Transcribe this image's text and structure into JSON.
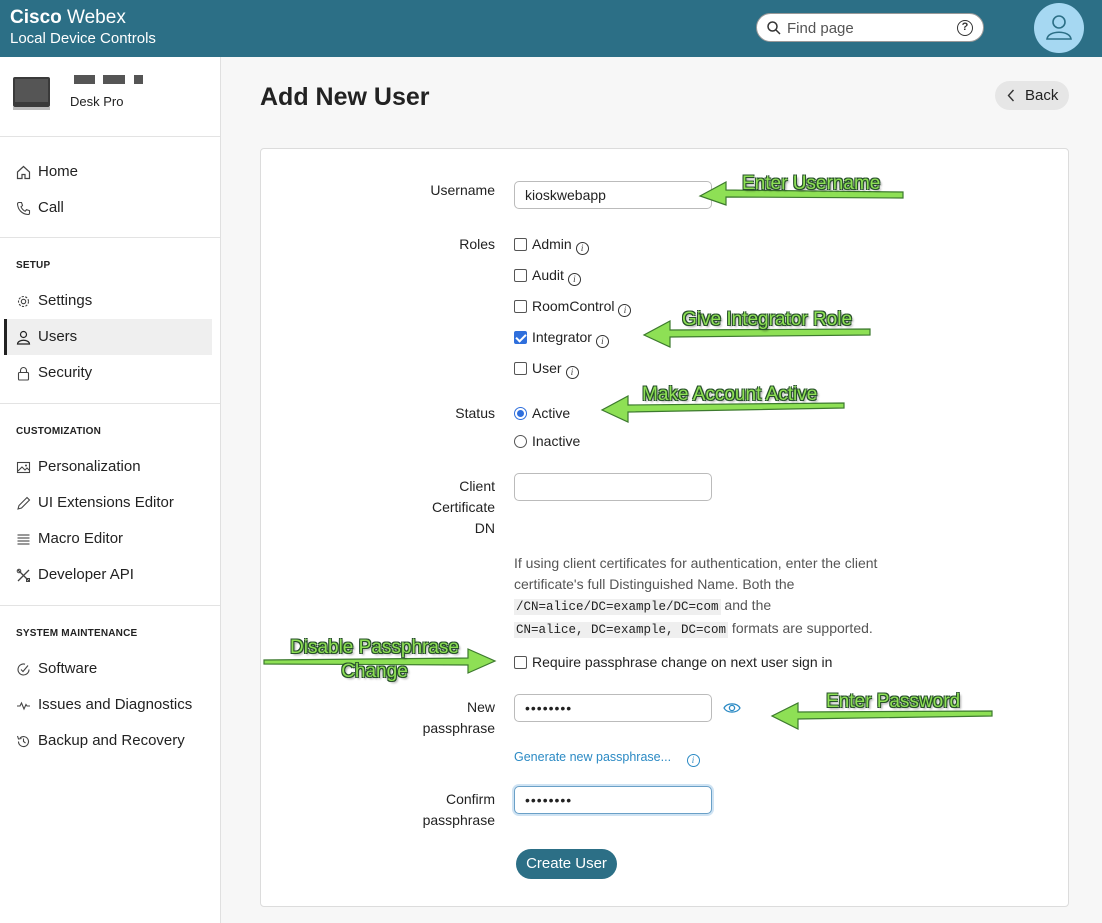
{
  "header": {
    "brand_bold": "Cisco",
    "brand_light": " Webex",
    "subtitle": "Local Device Controls",
    "search_placeholder": "Find page",
    "help_glyph": "?"
  },
  "device": {
    "name": "Desk Pro"
  },
  "sidebar": {
    "main": [
      {
        "label": "Home",
        "icon": "home-icon"
      },
      {
        "label": "Call",
        "icon": "phone-icon"
      }
    ],
    "setup_title": "SETUP",
    "setup": [
      {
        "label": "Settings",
        "icon": "gear-icon"
      },
      {
        "label": "Users",
        "icon": "user-icon",
        "active": true
      },
      {
        "label": "Security",
        "icon": "lock-icon"
      }
    ],
    "custom_title": "CUSTOMIZATION",
    "custom": [
      {
        "label": "Personalization",
        "icon": "image-icon"
      },
      {
        "label": "UI Extensions Editor",
        "icon": "pen-icon"
      },
      {
        "label": "Macro Editor",
        "icon": "lines-icon"
      },
      {
        "label": "Developer API",
        "icon": "tools-icon"
      }
    ],
    "maint_title": "SYSTEM MAINTENANCE",
    "maint": [
      {
        "label": "Software",
        "icon": "software-icon"
      },
      {
        "label": "Issues and Diagnostics",
        "icon": "pulse-icon"
      },
      {
        "label": "Backup and Recovery",
        "icon": "restore-icon"
      }
    ]
  },
  "main": {
    "title": "Add New User",
    "back_label": "Back"
  },
  "form": {
    "username_label": "Username",
    "username_value": "kioskwebapp",
    "roles_label": "Roles",
    "roles": [
      {
        "label": "Admin",
        "checked": false
      },
      {
        "label": "Audit",
        "checked": false
      },
      {
        "label": "RoomControl",
        "checked": false
      },
      {
        "label": "Integrator",
        "checked": true
      },
      {
        "label": "User",
        "checked": false
      }
    ],
    "status_label": "Status",
    "status_active": "Active",
    "status_inactive": "Inactive",
    "status_selected": "Active",
    "cert_label_1": "Client",
    "cert_label_2": "Certificate",
    "cert_label_3": "DN",
    "cert_value": "",
    "help_1": "If using client certificates for authentication, enter the client certificate's full Distinguished Name. Both the",
    "help_code_1": "/CN=alice/DC=example/DC=com",
    "help_2": " and the",
    "help_code_2": "CN=alice, DC=example, DC=com",
    "help_3": " formats are supported.",
    "require_change_label": "Require passphrase change on next user sign in",
    "require_change_checked": false,
    "new_pass_label_1": "New",
    "new_pass_label_2": "passphrase",
    "new_pass_value": "••••••••",
    "generate_label": "Generate new passphrase...",
    "confirm_label_1": "Confirm",
    "confirm_label_2": "passphrase",
    "confirm_value": "••••••••",
    "create_label": "Create User"
  },
  "annotations": {
    "username": "Enter Username",
    "integrator": "Give Integrator Role",
    "active": "Make Account Active",
    "disable_1": "Disable Passphrase",
    "disable_2": "Change",
    "password": "Enter Password"
  },
  "colors": {
    "header_bg": "#2c6f86",
    "accent_blue": "#2f6fdc",
    "annotation_green": "#8ee055",
    "link": "#2b8ac4"
  }
}
